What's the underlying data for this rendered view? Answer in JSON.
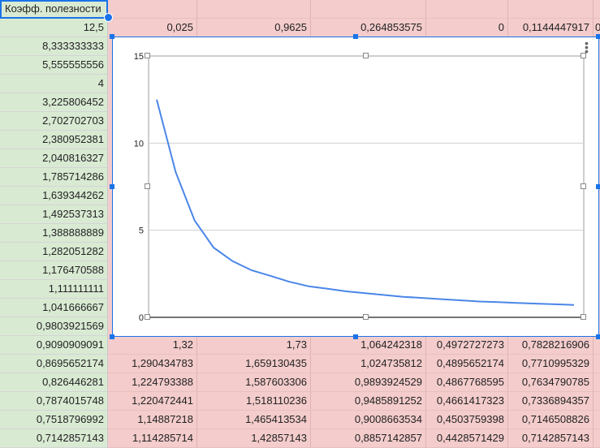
{
  "header": {
    "label": "Коэфф. полезности"
  },
  "row1": [
    "12,5",
    "0,025",
    "0,9625",
    "0,264853575",
    "0",
    "0,1144447917",
    "0"
  ],
  "colA": [
    "8,333333333",
    "5,555555556",
    "4",
    "3,225806452",
    "2,702702703",
    "2,380952381",
    "2,040816327",
    "1,785714286",
    "1,639344262",
    "1,492537313",
    "1,388888889",
    "1,282051282",
    "1,176470588",
    "1,111111111",
    "1,041666667",
    "0,9803921569",
    "0,9090909091",
    "0,8695652174",
    "0,826446281",
    "0,7874015748",
    "0,7518796992",
    "0,7142857143"
  ],
  "lower_rows": [
    [
      "1,32",
      "1,73",
      "1,064242318",
      "0,4972727273",
      "0,7828216906"
    ],
    [
      "1,290434783",
      "1,659130435",
      "1,024735812",
      "0,4895652174",
      "0,7710995329"
    ],
    [
      "1,224793388",
      "1,587603306",
      "0,9893924529",
      "0,4867768595",
      "0,7634790785"
    ],
    [
      "1,220472441",
      "1,518110236",
      "0,9485891252",
      "0,4661417323",
      "0,7336894357"
    ],
    [
      "1,14887218",
      "1,465413534",
      "0,9008663534",
      "0,4503759398",
      "0,7146508826"
    ],
    [
      "1,114285714",
      "1,42857143",
      "0,8857142857",
      "0,4428571429",
      "0,7142857143"
    ]
  ],
  "chart_data": {
    "type": "line",
    "title": "",
    "xlabel": "",
    "ylabel": "",
    "ylim": [
      0,
      15
    ],
    "yticks": [
      "0",
      "5",
      "10",
      "15"
    ],
    "grid": true,
    "series": [
      {
        "color": "#4a86e8",
        "values": [
          12.5,
          8.333333333,
          5.555555556,
          4,
          3.225806452,
          2.702702703,
          2.380952381,
          2.040816327,
          1.785714286,
          1.639344262,
          1.492537313,
          1.388888889,
          1.282051282,
          1.176470588,
          1.111111111,
          1.041666667,
          0.9803921569,
          0.9090909091,
          0.8695652174,
          0.826446281,
          0.7874015748,
          0.7518796992,
          0.7142857143
        ]
      }
    ]
  },
  "icons": {
    "menu": "more-vert-icon"
  }
}
